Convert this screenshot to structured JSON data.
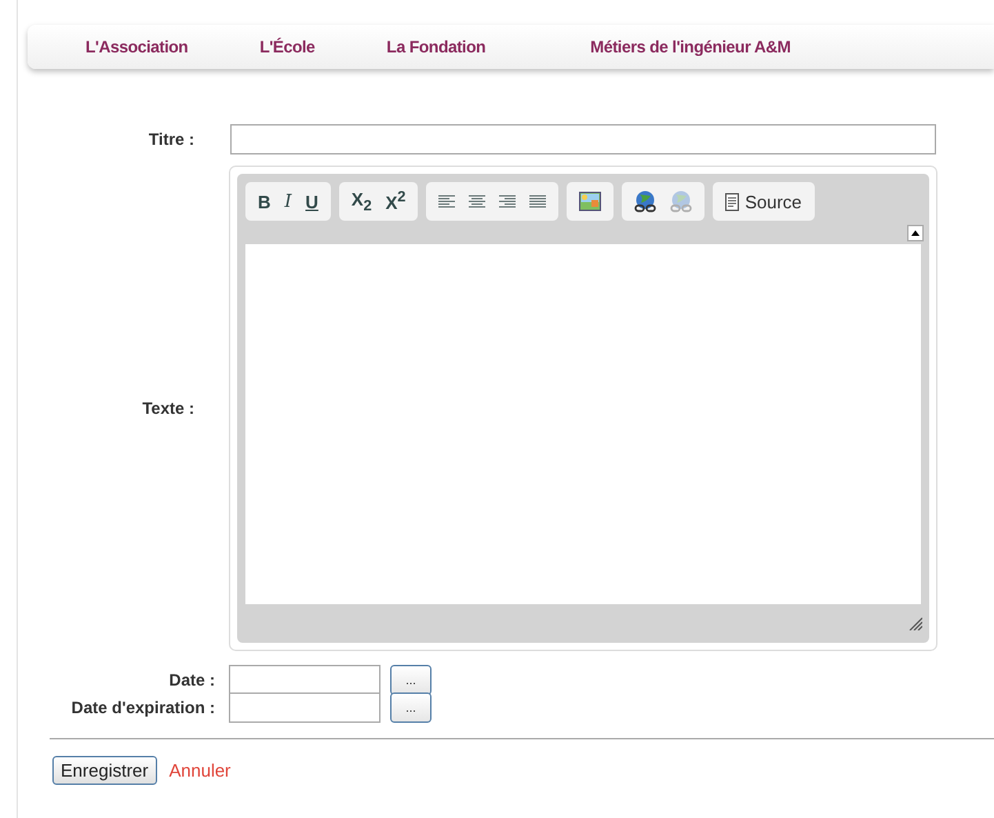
{
  "nav": [
    {
      "label": "L'Association"
    },
    {
      "label": "L'École"
    },
    {
      "label": "La Fondation"
    },
    {
      "label": "Métiers de l'ingénieur A&M"
    }
  ],
  "title_field": {
    "label": "Titre :"
  },
  "text_field": {
    "label": "Texte :"
  },
  "toolbar": [
    {
      "items": [
        {
          "kind": "bold",
          "text": "B",
          "disabled": false
        },
        {
          "kind": "italic",
          "text": "I",
          "disabled": false
        },
        {
          "kind": "underline",
          "text": "U",
          "disabled": false
        }
      ]
    },
    {
      "items": [
        {
          "kind": "script",
          "text": "X$_{2}$",
          "disabled": false
        },
        {
          "kind": "script",
          "text": "X$^{2}$",
          "disabled": false
        }
      ]
    },
    {
      "items": [
        {
          "kind": "align-left",
          "disabled": false
        },
        {
          "kind": "align-center",
          "disabled": false
        },
        {
          "kind": "align-right",
          "disabled": false
        },
        {
          "kind": "justify",
          "disabled": false
        }
      ]
    },
    {
      "items": [
        {
          "kind": "image",
          "disabled": false
        }
      ]
    },
    {
      "items": [
        {
          "kind": "globe",
          "disabled": false
        },
        {
          "kind": "globe",
          "disabled": true
        }
      ]
    },
    {
      "items": [
        {
          "kind": "source",
          "text": "Source",
          "disabled": false
        }
      ]
    }
  ],
  "date_fields": [
    {
      "label": "Date :",
      "button": "..."
    },
    {
      "label": "Date d'expiration :",
      "button": "..."
    }
  ],
  "save_button": "Enregistrer",
  "cancel_link": "Annuler"
}
